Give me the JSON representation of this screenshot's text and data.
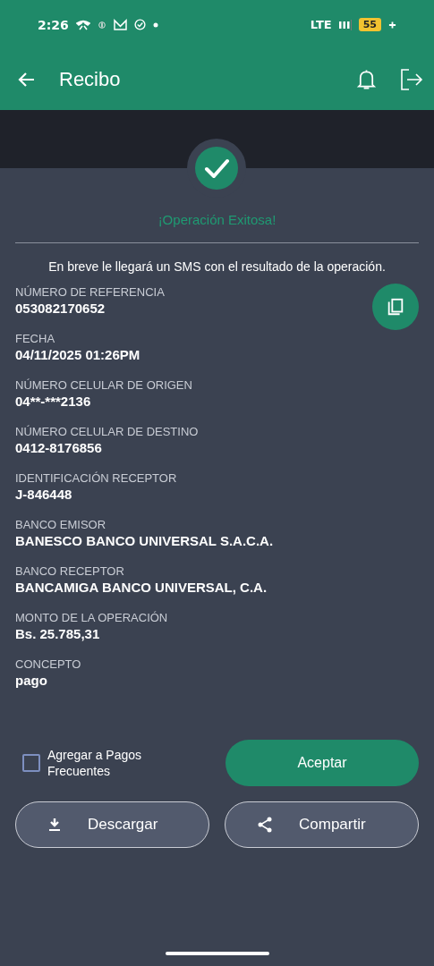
{
  "status_bar": {
    "time": "2:26",
    "network": "LTE",
    "battery": "55"
  },
  "app_bar": {
    "title": "Recibo"
  },
  "result": {
    "title": "¡Operación Exitosa!",
    "message": "En breve le llegará un SMS con el resultado de la operación."
  },
  "fields": [
    {
      "label": "NÚMERO DE REFERENCIA",
      "value": "053082170652"
    },
    {
      "label": "FECHA",
      "value": "04/11/2025 01:26PM"
    },
    {
      "label": "NÚMERO CELULAR DE ORIGEN",
      "value": "04**-***2136"
    },
    {
      "label": "NÚMERO CELULAR DE DESTINO",
      "value": "0412-8176856"
    },
    {
      "label": "IDENTIFICACIÓN RECEPTOR",
      "value": "J-846448"
    },
    {
      "label": "BANCO EMISOR",
      "value": "BANESCO BANCO UNIVERSAL S.A.C.A."
    },
    {
      "label": "BANCO RECEPTOR",
      "value": "BANCAMIGA BANCO UNIVERSAL, C.A."
    },
    {
      "label": "MONTO DE LA OPERACIÓN",
      "value": "Bs. 25.785,31"
    },
    {
      "label": "CONCEPTO",
      "value": "pago"
    }
  ],
  "frequent_checkbox": {
    "label": "Agregar a Pagos Frecuentes",
    "checked": false
  },
  "accept_button": "Aceptar",
  "actions": [
    {
      "kind": "download",
      "label": "Descargar"
    },
    {
      "kind": "share",
      "label": "Compartir"
    }
  ]
}
